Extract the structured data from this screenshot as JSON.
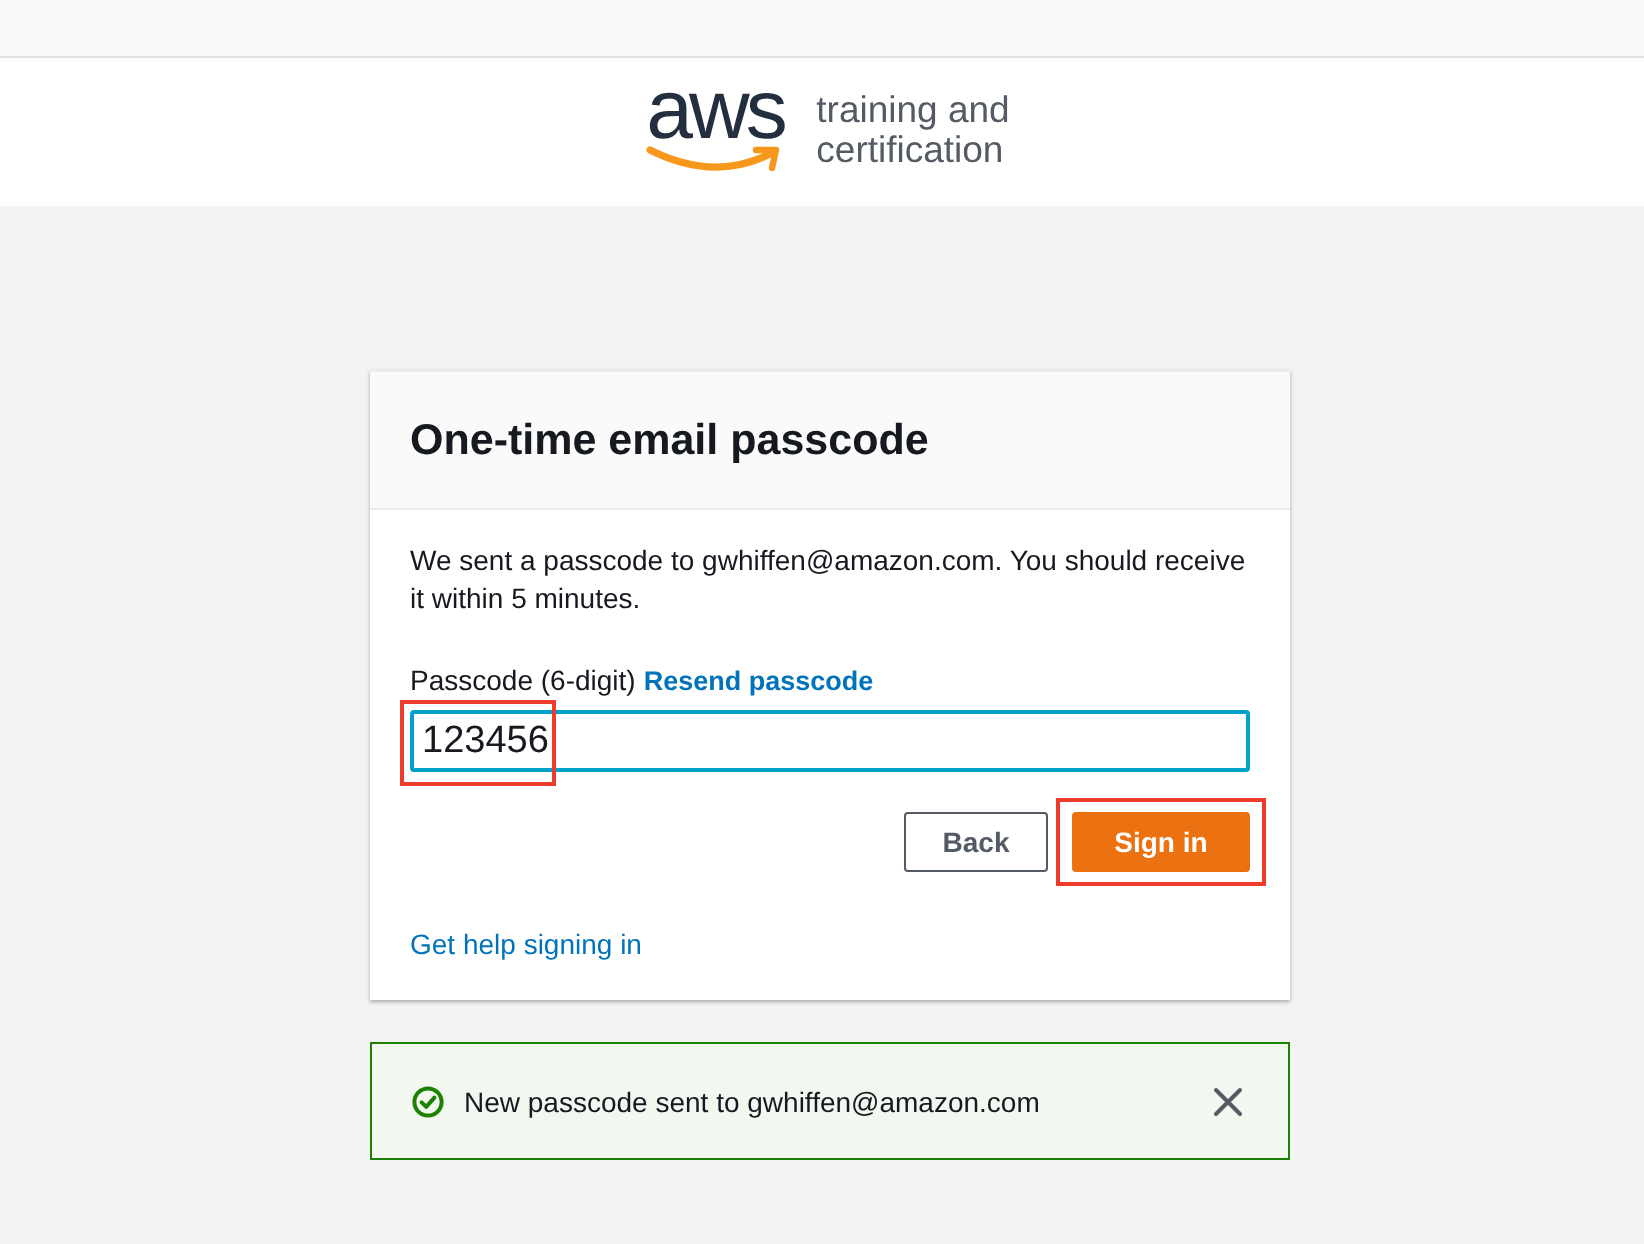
{
  "header": {
    "logo": {
      "wordmark": "aws",
      "tagline": [
        "training and",
        "certification"
      ]
    }
  },
  "card": {
    "title": "One-time email passcode",
    "message": "We sent a passcode to gwhiffen@amazon.com. You should receive it within 5 minutes.",
    "passcode": {
      "label": "Passcode (6-digit)",
      "link": "Resend passcode",
      "value": "123456",
      "focused": true,
      "highlighted": true
    },
    "buttons": [
      {
        "label": "Back",
        "kind": "secondary",
        "highlighted": false
      },
      {
        "label": "Sign in",
        "kind": "primary",
        "highlighted": true
      }
    ],
    "help_link": "Get help signing in"
  },
  "alert": {
    "kind": "success",
    "message": "New passcode sent to gwhiffen@amazon.com"
  }
}
